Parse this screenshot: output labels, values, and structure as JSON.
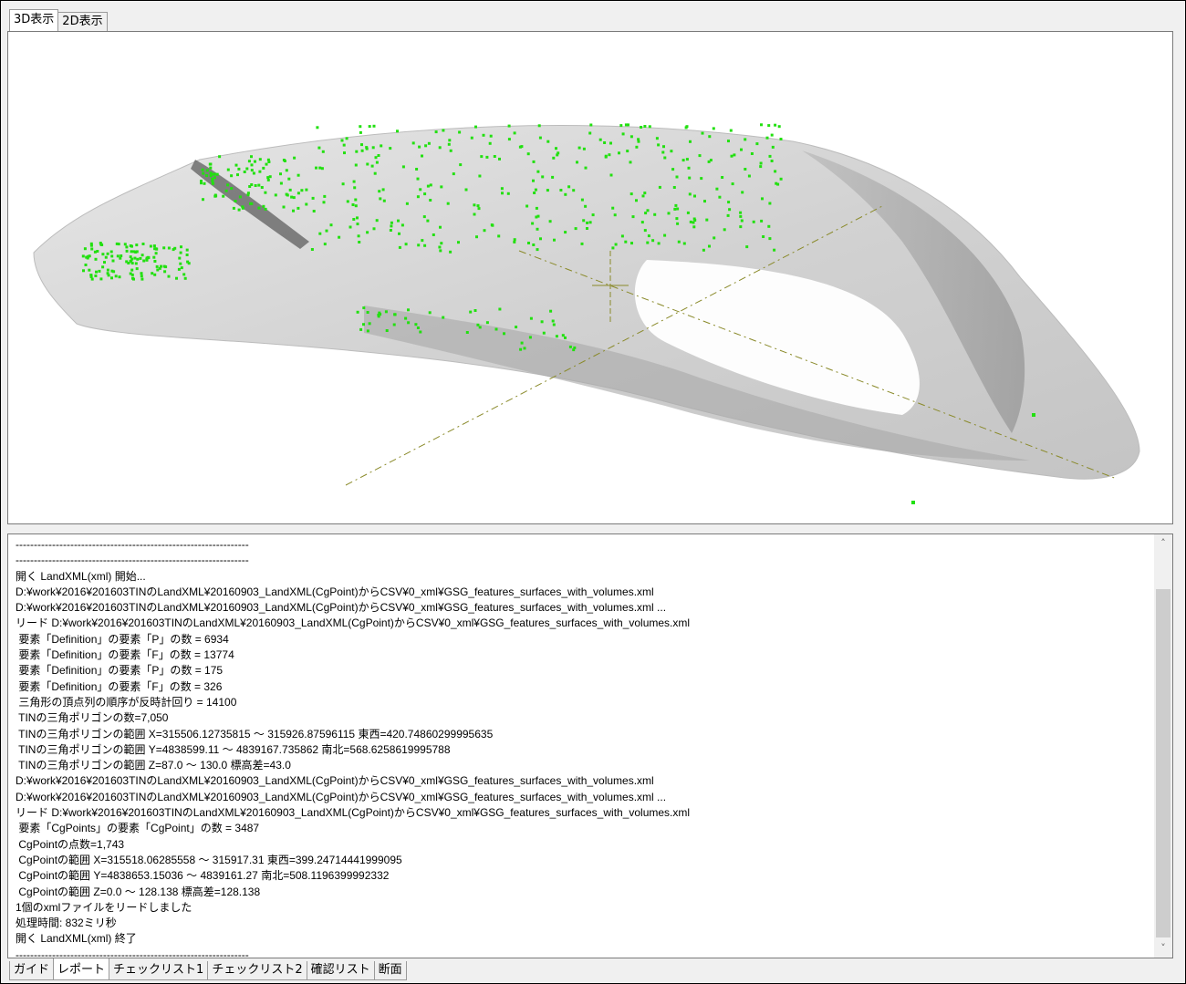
{
  "top_tabs": [
    {
      "label": "3D表示",
      "active": true
    },
    {
      "label": "2D表示",
      "active": false
    }
  ],
  "viewport": {
    "mesh_color": "#d8d8d8",
    "point_color": "#22e010",
    "axis_color": "#8a8a2a"
  },
  "log_lines": [
    "----------------------------------------------------------------",
    "----------------------------------------------------------------",
    "開く LandXML(xml) 開始...",
    "D:¥work¥2016¥201603TINのLandXML¥20160903_LandXML(CgPoint)からCSV¥0_xml¥GSG_features_surfaces_with_volumes.xml",
    "D:¥work¥2016¥201603TINのLandXML¥20160903_LandXML(CgPoint)からCSV¥0_xml¥GSG_features_surfaces_with_volumes.xml ...",
    "リード D:¥work¥2016¥201603TINのLandXML¥20160903_LandXML(CgPoint)からCSV¥0_xml¥GSG_features_surfaces_with_volumes.xml",
    " 要素「Definition」の要素「P」の数 = 6934",
    " 要素「Definition」の要素「F」の数 = 13774",
    " 要素「Definition」の要素「P」の数 = 175",
    " 要素「Definition」の要素「F」の数 = 326",
    " 三角形の頂点列の順序が反時計回り = 14100",
    " TINの三角ポリゴンの数=7,050",
    " TINの三角ポリゴンの範囲 X=315506.12735815 〜 315926.87596115 東西=420.74860299995635",
    " TINの三角ポリゴンの範囲 Y=4838599.11 〜 4839167.735862 南北=568.6258619995788",
    " TINの三角ポリゴンの範囲 Z=87.0 〜 130.0 標高差=43.0",
    "D:¥work¥2016¥201603TINのLandXML¥20160903_LandXML(CgPoint)からCSV¥0_xml¥GSG_features_surfaces_with_volumes.xml",
    "D:¥work¥2016¥201603TINのLandXML¥20160903_LandXML(CgPoint)からCSV¥0_xml¥GSG_features_surfaces_with_volumes.xml ...",
    "リード D:¥work¥2016¥201603TINのLandXML¥20160903_LandXML(CgPoint)からCSV¥0_xml¥GSG_features_surfaces_with_volumes.xml",
    " 要素「CgPoints」の要素「CgPoint」の数 = 3487",
    " CgPointの点数=1,743",
    " CgPointの範囲 X=315518.06285558 〜 315917.31 東西=399.24714441999095",
    " CgPointの範囲 Y=4838653.15036 〜 4839161.27 南北=508.1196399992332",
    " CgPointの範囲 Z=0.0 〜 128.138 標高差=128.138",
    "1個のxmlファイルをリードしました",
    "処理時間: 832ミリ秒",
    "開く LandXML(xml) 終了",
    "----------------------------------------------------------------"
  ],
  "bottom_tabs": [
    {
      "label": "ガイド",
      "active": false
    },
    {
      "label": "レポート",
      "active": true
    },
    {
      "label": "チェックリスト1",
      "active": false
    },
    {
      "label": "チェックリスト2",
      "active": false
    },
    {
      "label": "確認リスト",
      "active": false
    },
    {
      "label": "断面",
      "active": false
    }
  ],
  "scrollbar": {
    "up_icon": "chevron-up-icon",
    "down_icon": "chevron-down-icon"
  }
}
